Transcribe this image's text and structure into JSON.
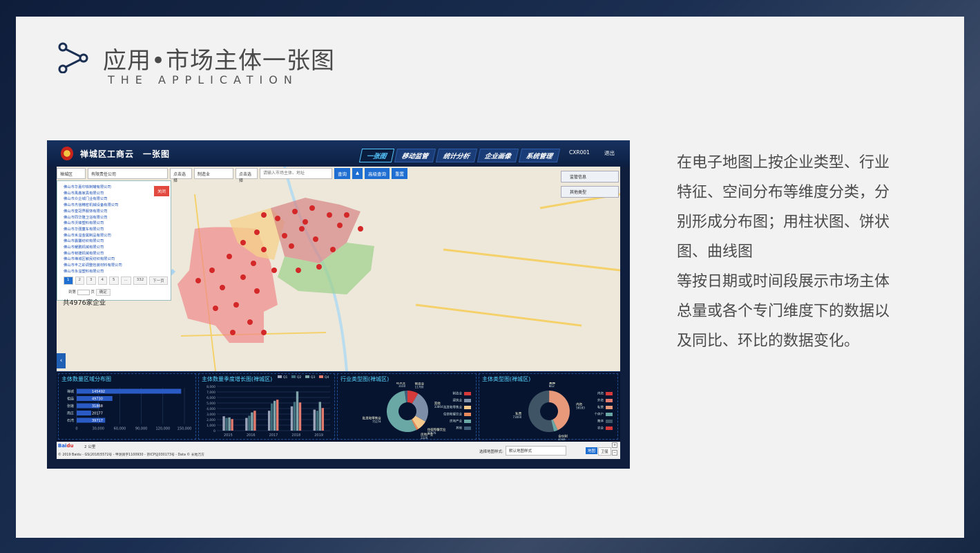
{
  "slide": {
    "title": "应用•市场主体一张图",
    "subtitle": "THE APPLICATION",
    "description": [
      "在电子地图上按企业类型、行业",
      "特征、空间分布等维度分类，分",
      "别形成分布图；用柱状图、饼状",
      "图、曲线图",
      "等按日期或时间段展示市场主体",
      "总量或各个专门维度下的数据以",
      "及同比、环比的数据变化。"
    ]
  },
  "app": {
    "title": "禅城区工商云　一张图",
    "nav": [
      "一张图",
      "移动监管",
      "统计分析",
      "企业画像",
      "系统管理"
    ],
    "user": "CXR001",
    "logout": "退出"
  },
  "search": {
    "district": "禅城区",
    "type": "有限责任公司",
    "pick1": "点击选择",
    "industry": "制造业",
    "pick2": "点击选择",
    "keyword_placeholder": "请输入市场主体、地址",
    "query": "查询",
    "advanced": "高级查询",
    "reset": "重置"
  },
  "list": {
    "close": "关闭",
    "items": [
      "佛山市华嘉印铁制罐有限公司",
      "佛山市禹鑫家具有限公司",
      "佛山市众企城门业有限公司",
      "佛山市杰信精密机械设备有限公司",
      "佛山市皇冠界服饰有限公司",
      "佛山市同华隆卫浴有限公司",
      "佛山市沃锋塑料有限公司",
      "佛山市华强童车有限公司",
      "佛山市禾溢金属制品有限公司",
      "佛山市震馨纺织有限公司",
      "佛山市耀鹏机械有限公司",
      "佛山市韧捷机械有限公司",
      "佛山市禅城区敏民纺织有限公司",
      "佛山市丰之彩调整包装材料有限公司",
      "佛山市永溢塑料有限公司"
    ],
    "pages": [
      "1",
      "2",
      "3",
      "4",
      "5",
      "...",
      "332",
      "下一页"
    ],
    "jump_label": "到第",
    "page_unit": "页",
    "confirm": "确定",
    "total": "共4976家企业"
  },
  "map_filters": {
    "supervision": "监管信息",
    "other": "其他类型"
  },
  "charts": [
    {
      "type": "bar",
      "title": "主体数量区域分布图",
      "categories": [
        "禅城",
        "祖庙",
        "张槎",
        "南庄",
        "石湾"
      ],
      "values": [
        145492,
        49730,
        31868,
        20177,
        39717
      ],
      "xlim": [
        0,
        150000
      ],
      "xticks": [
        "0",
        "30,000",
        "60,000",
        "90,000",
        "120,000",
        "150,000"
      ]
    },
    {
      "type": "bar",
      "title": "主体数量季度增长图(禅城区)",
      "series": [
        {
          "name": "Q1",
          "color": "#9aa3b8",
          "values": [
            2600,
            2300,
            3600,
            4400,
            3800
          ]
        },
        {
          "name": "Q2",
          "color": "#3f6d7a",
          "values": [
            2300,
            2700,
            4900,
            5200,
            3600
          ]
        },
        {
          "name": "Q3",
          "color": "#7ea3a8",
          "values": [
            2400,
            3300,
            5400,
            7100,
            5200
          ]
        },
        {
          "name": "Q4",
          "color": "#e27b6e",
          "values": [
            2100,
            3600,
            5600,
            5100,
            4100
          ]
        }
      ],
      "categories": [
        "2015",
        "2016",
        "2017",
        "2018",
        "2019"
      ],
      "ylim": [
        0,
        8000
      ],
      "yticks": [
        "0",
        "1,000",
        "2,000",
        "3,000",
        "4,000",
        "5,000",
        "6,000",
        "7,000",
        "8,000"
      ]
    },
    {
      "type": "pie",
      "title": "行业类型图(禅城区)",
      "slices": [
        {
          "label": "制造业",
          "value": 11780,
          "color": "#d73a3a"
        },
        {
          "label": "其他",
          "value": 33864,
          "color": "#7d8ea8"
        },
        {
          "label": "住宿和餐饮业",
          "value": 10976,
          "color": "#f5c88c"
        },
        {
          "label": "房地产业",
          "value": 2226,
          "color": "#e88a5c"
        },
        {
          "label": "批发和零售业",
          "value": 75274,
          "color": "#6aa8a6"
        },
        {
          "label": "建筑业",
          "value": 3100,
          "color": "#41607a"
        }
      ],
      "legend": [
        "制造业",
        "建筑业",
        "批发和零售业",
        "住宿和餐饮业",
        "房地产业",
        "其他"
      ]
    },
    {
      "type": "pie",
      "title": "主体类型图(禅城区)",
      "slices": [
        {
          "label": "外资",
          "value": 6,
          "color": "#d73a3a"
        },
        {
          "label": "集体",
          "value": 212,
          "color": "#e27b6e"
        },
        {
          "label": "内资",
          "value": 58183,
          "color": "#e8997a"
        },
        {
          "label": "合伙制",
          "value": 4240,
          "color": "#6aa8a6"
        },
        {
          "label": "私营",
          "value": 73000,
          "color": "#3f5566"
        }
      ],
      "legend": [
        "内资",
        "外资",
        "私营",
        "个体户",
        "集体",
        "农合"
      ]
    }
  ],
  "footer": {
    "scale": "2 公里",
    "copyright": "© 2019 Baidu - GS(2018)5572号 - 甲测资字1100930 - 京ICP证030173号 - Data © 长地万方",
    "map_style_label": "选择地图样式:",
    "map_style_value": "默认地图样式",
    "map_btn": "地图",
    "satellite_btn": "卫星"
  }
}
